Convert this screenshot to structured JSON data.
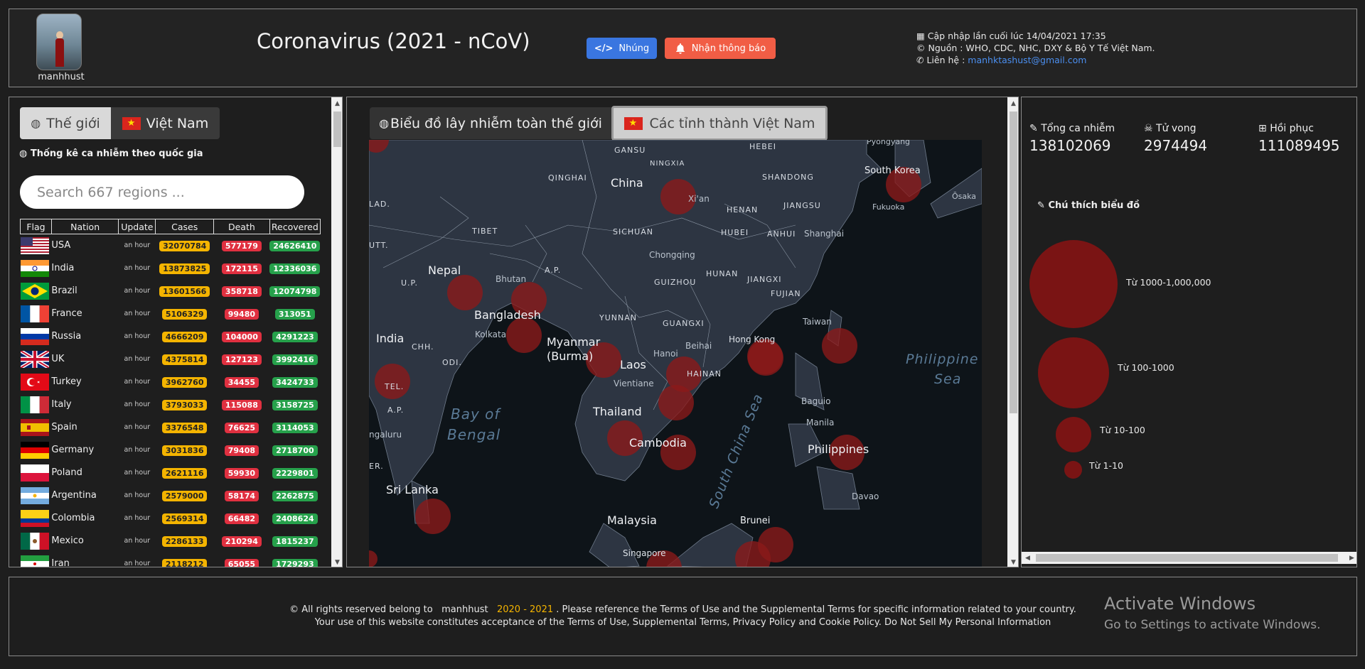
{
  "header": {
    "username": "manhhust",
    "title": "Coronavirus (2021 - nCoV)",
    "embed_button": "Nhúng",
    "notify_button": "Nhận thông báo",
    "updated": "Cập nhập lần cuối lúc 14/04/2021 17:35",
    "source": "Nguồn : WHO, CDC, NHC, DXY & Bộ Y Tế Việt Nam.",
    "contact_label": "Liên hệ :",
    "contact_email": "manhktashust@gmail.com"
  },
  "left": {
    "tab_world": "Thế giới",
    "tab_vn": "Việt Nam",
    "section_title": "Thống kê ca nhiễm theo quốc gia",
    "search_placeholder": "Search 667 regions ...",
    "columns": [
      "Flag",
      "Nation",
      "Update",
      "Cases",
      "Death",
      "Recovered"
    ],
    "rows": [
      {
        "nation": "USA",
        "update": "an hour",
        "cases": "32070784",
        "death": "577179",
        "recovered": "24626410",
        "flag": "usa"
      },
      {
        "nation": "India",
        "update": "an hour",
        "cases": "13873825",
        "death": "172115",
        "recovered": "12336036",
        "flag": "india"
      },
      {
        "nation": "Brazil",
        "update": "an hour",
        "cases": "13601566",
        "death": "358718",
        "recovered": "12074798",
        "flag": "brazil"
      },
      {
        "nation": "France",
        "update": "an hour",
        "cases": "5106329",
        "death": "99480",
        "recovered": "313051",
        "flag": "france"
      },
      {
        "nation": "Russia",
        "update": "an hour",
        "cases": "4666209",
        "death": "104000",
        "recovered": "4291223",
        "flag": "russia"
      },
      {
        "nation": "UK",
        "update": "an hour",
        "cases": "4375814",
        "death": "127123",
        "recovered": "3992416",
        "flag": "uk"
      },
      {
        "nation": "Turkey",
        "update": "an hour",
        "cases": "3962760",
        "death": "34455",
        "recovered": "3424733",
        "flag": "turkey"
      },
      {
        "nation": "Italy",
        "update": "an hour",
        "cases": "3793033",
        "death": "115088",
        "recovered": "3158725",
        "flag": "italy"
      },
      {
        "nation": "Spain",
        "update": "an hour",
        "cases": "3376548",
        "death": "76625",
        "recovered": "3114053",
        "flag": "spain"
      },
      {
        "nation": "Germany",
        "update": "an hour",
        "cases": "3031836",
        "death": "79408",
        "recovered": "2718700",
        "flag": "germany"
      },
      {
        "nation": "Poland",
        "update": "an hour",
        "cases": "2621116",
        "death": "59930",
        "recovered": "2229801",
        "flag": "poland"
      },
      {
        "nation": "Argentina",
        "update": "an hour",
        "cases": "2579000",
        "death": "58174",
        "recovered": "2262875",
        "flag": "argentina"
      },
      {
        "nation": "Colombia",
        "update": "an hour",
        "cases": "2569314",
        "death": "66482",
        "recovered": "2408624",
        "flag": "colombia"
      },
      {
        "nation": "Mexico",
        "update": "an hour",
        "cases": "2286133",
        "death": "210294",
        "recovered": "1815237",
        "flag": "mexico"
      },
      {
        "nation": "Iran",
        "update": "an hour",
        "cases": "2118212",
        "death": "65055",
        "recovered": "1729293",
        "flag": "iran"
      }
    ]
  },
  "map": {
    "tab_world": "Biểu đồ lây nhiễm toàn thế giới",
    "tab_vn": "Các tỉnh thành Việt Nam",
    "labels": {
      "gansu": "GANSU",
      "hebei": "HEBEI",
      "pyongyang": "Pyongyang",
      "ningxia": "NINGXIA",
      "qinghai": "QINGHAI",
      "china": "China",
      "shandong": "SHANDONG",
      "south_korea": "South Korea",
      "xian": "Xi'an",
      "henan": "HENAN",
      "jiangsu": "JIANGSU",
      "fukuoka": "Fukuoka",
      "osaka": "Ōsaka",
      "lad": "LAD.",
      "tibet": "TIBET",
      "sichuan": "SICHUAN",
      "hubei": "HUBEI",
      "anhui": "ANHUI",
      "shanghai": "Shanghai",
      "utt": "UTT.",
      "chongqing": "Chongqing",
      "nepal": "Nepal",
      "bhutan": "Bhutan",
      "ap1": "A.P.",
      "up": "U.P.",
      "guizhou": "GUIZHOU",
      "hunan": "HUNAN",
      "jiangxi": "JIANGXI",
      "fujian": "FUJIAN",
      "bangladesh": "Bangladesh",
      "kolkata": "Kolkata",
      "yunnan": "YUNNAN",
      "taiwan": "Taiwan",
      "myanmar": "Myanmar",
      "burma": "(Burma)",
      "guangxi": "GUANGXI",
      "hong_kong": "Hong Kong",
      "india": "India",
      "chh": "CHH.",
      "odi": "ODI.",
      "hanoi": "Hanoi",
      "beihai": "Beihai",
      "laos": "Laos",
      "philippine": "Philippine",
      "sea": "Sea",
      "hainan": "HAINAN",
      "vientiane": "Vientiane",
      "tel": "TEL.",
      "ap2": "A.P.",
      "bay_of": "Bay of",
      "bengal": "Bengal",
      "thailand": "Thailand",
      "baguio": "Baguio",
      "manila": "Manila",
      "ngaluru": "ngaluru",
      "cambodia": "Cambodia",
      "south_china_sea": "South China Sea",
      "philippines": "Philippines",
      "er": "ER.",
      "sri_lanka": "Sri Lanka",
      "davao": "Davao",
      "malaysia": "Malaysia",
      "brunei": "Brunei",
      "singapore": "Singapore"
    }
  },
  "stats": {
    "total_label": "Tổng ca nhiễm",
    "total_value": "138102069",
    "death_label": "Tử vong",
    "death_value": "2974494",
    "recovered_label": "Hồi phục",
    "recovered_value": "111089495",
    "legend_title": "Chú thích biểu đồ",
    "legend": [
      {
        "label": "Từ 1000-1,000,000"
      },
      {
        "label": "Từ 100-1000"
      },
      {
        "label": "Từ 10-100"
      },
      {
        "label": "Từ 1-10"
      }
    ],
    "bubble_color": "#7a1414"
  },
  "footer": {
    "line1_pre": "© All rights reserved belong to",
    "line1_name": "manhhust",
    "line1_years": "2020 - 2021",
    "line1_post": ". Please reference the Terms of Use and the Supplemental Terms for specific information related to your country.",
    "line2": "Your use of this website constitutes acceptance of the Terms of Use, Supplemental Terms, Privacy Policy and Cookie Policy. Do Not Sell My Personal Information"
  },
  "watermark": {
    "title": "Activate Windows",
    "subtitle": "Go to Settings to activate Windows."
  }
}
